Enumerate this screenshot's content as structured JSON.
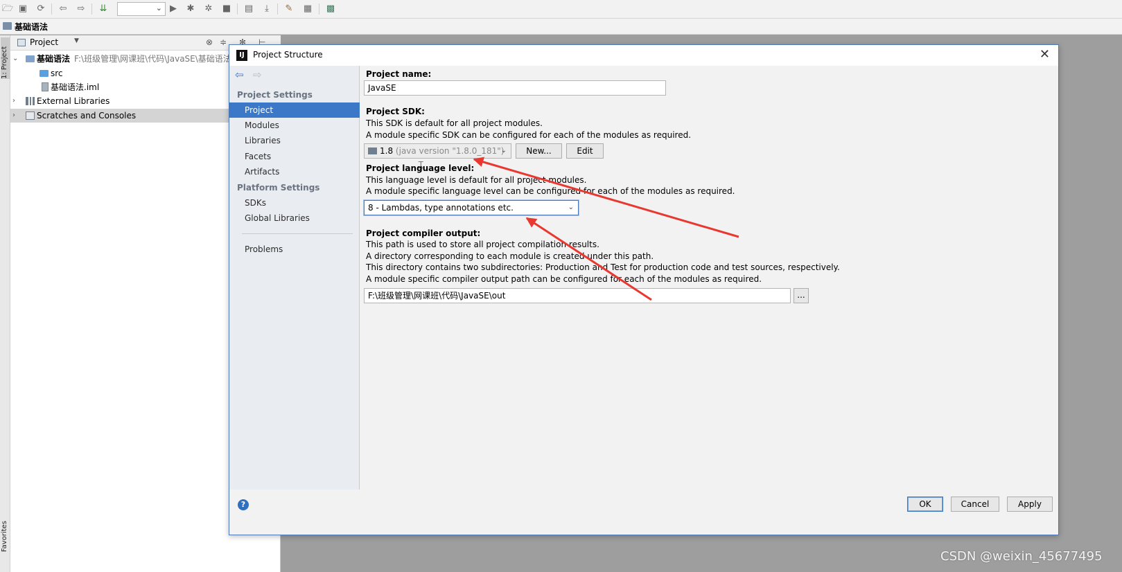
{
  "navbar": {
    "project_label": "基础语法"
  },
  "left_strip": {
    "project_tab": "1: Project",
    "favorites_tab": "Favorites"
  },
  "project_panel": {
    "title": "Project",
    "tree": {
      "root_name": "基础语法",
      "root_path": "F:\\班级管理\\网课班\\代码\\JavaSE\\基础语法",
      "src": "src",
      "iml": "基础语法.iml",
      "external_libraries": "External Libraries",
      "scratches": "Scratches and Consoles"
    }
  },
  "dialog": {
    "title": "Project Structure",
    "close_glyph": "✕",
    "sidebar": {
      "project_settings_header": "Project Settings",
      "project_settings_items": [
        "Project",
        "Modules",
        "Libraries",
        "Facets",
        "Artifacts"
      ],
      "selected_item": "Project",
      "platform_settings_header": "Platform Settings",
      "platform_settings_items": [
        "SDKs",
        "Global Libraries"
      ],
      "problems": "Problems"
    },
    "content": {
      "project_name_label": "Project name:",
      "project_name_value": "JavaSE",
      "sdk_label": "Project SDK:",
      "sdk_desc_1": "This SDK is default for all project modules.",
      "sdk_desc_2": "A module specific SDK can be configured for each of the modules as required.",
      "sdk_value": "1.8",
      "sdk_detail": "(java version \"1.8.0_181\")",
      "sdk_new_button": "New...",
      "sdk_edit_button": "Edit",
      "lang_label": "Project language level:",
      "lang_desc_1": "This language level is default for all project modules.",
      "lang_desc_2": "A module specific language level can be configured for each of the modules as required.",
      "lang_value": "8 - Lambdas, type annotations etc.",
      "output_label": "Project compiler output:",
      "output_desc_1": "This path is used to store all project compilation results.",
      "output_desc_2": "A directory corresponding to each module is created under this path.",
      "output_desc_3": "This directory contains two subdirectories: Production and Test for production code and test sources, respectively.",
      "output_desc_4": "A module specific compiler output path can be configured for each of the modules as required.",
      "output_path": "F:\\班级管理\\网课班\\代码\\JavaSE\\out",
      "browse_button": "..."
    },
    "footer": {
      "help_glyph": "?",
      "ok": "OK",
      "cancel": "Cancel",
      "apply": "Apply"
    }
  },
  "watermark": "CSDN @weixin_45677495",
  "colors": {
    "selection": "#3b78c8",
    "annotation_arrow": "#e8382f",
    "dialog_border": "#4d7ab6"
  }
}
